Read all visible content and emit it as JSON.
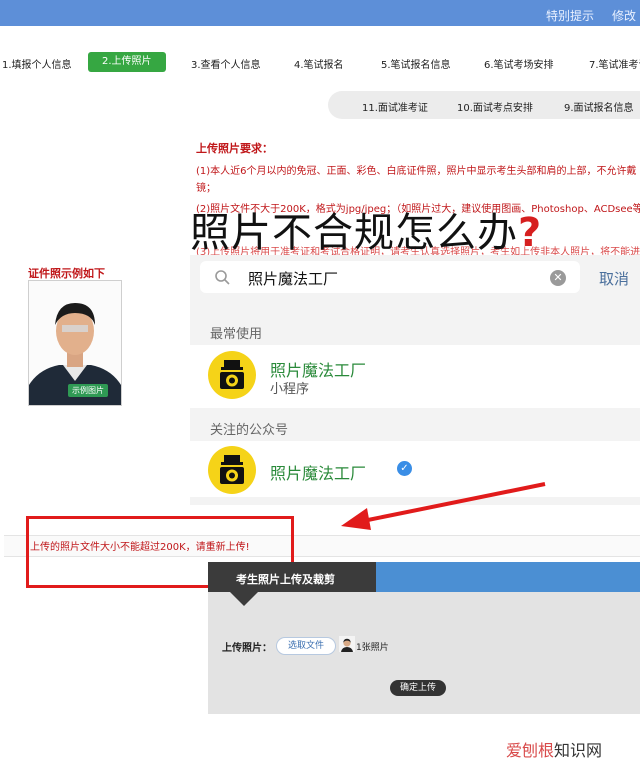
{
  "top_links": [
    "特别提示",
    "修改"
  ],
  "steps": [
    {
      "label": "1.填报个人信息",
      "active": false
    },
    {
      "label": "2.上传照片",
      "active": true
    },
    {
      "label": "3.查看个人信息",
      "active": false
    },
    {
      "label": "4.笔试报名",
      "active": false
    },
    {
      "label": "5.笔试报名信息",
      "active": false
    },
    {
      "label": "6.笔试考场安排",
      "active": false
    },
    {
      "label": "7.笔试准考证",
      "active": false
    }
  ],
  "tabs2": [
    "11.面试准考证",
    "10.面试考点安排",
    "9.面试报名信息"
  ],
  "requirements": {
    "title": "上传照片要求：",
    "line1": "(1)本人近6个月以内的免冠、正面、彩色、白底证件照，照片中显示考生头部和肩的上部，不允许戴",
    "line1_cont": "镜；",
    "line2": "(2)照片文件不大于200K，格式为jpg/jpeg；（如照片过大，建议使用图画、Photoshop、ACDsee等工",
    "line3": "(3)上传照片将用于准考证和考试合格证明，请考生认真选择照片，考生如上传非本人照片，将不能进"
  },
  "overlay": {
    "title": "照片不合规怎么办",
    "qmark": "?"
  },
  "sample": {
    "label": "证件照示例如下",
    "badge": "示例图片"
  },
  "wechat": {
    "search_text": "照片魔法工厂",
    "cancel": "取消",
    "section_frequent": "最常使用",
    "mini_name": "照片魔法工厂",
    "mini_type": "小程序",
    "section_follow": "关注的公众号",
    "official_name": "照片魔法工厂"
  },
  "error": "上传的照片文件大小不能超过200K，请重新上传!",
  "upload": {
    "header": "考生照片上传及裁剪",
    "label": "上传照片：",
    "choose": "选取文件",
    "count": "1张照片",
    "confirm": "确定上传"
  },
  "watermark": {
    "part1": "爱刨根",
    "part2": "知识网"
  },
  "colors": {
    "step_active": "#36a742",
    "error_red": "#c0171a",
    "highlight_red": "#e11b1b",
    "wechat_green": "#2a8a3a",
    "panel_blue": "#4b8fd3"
  }
}
